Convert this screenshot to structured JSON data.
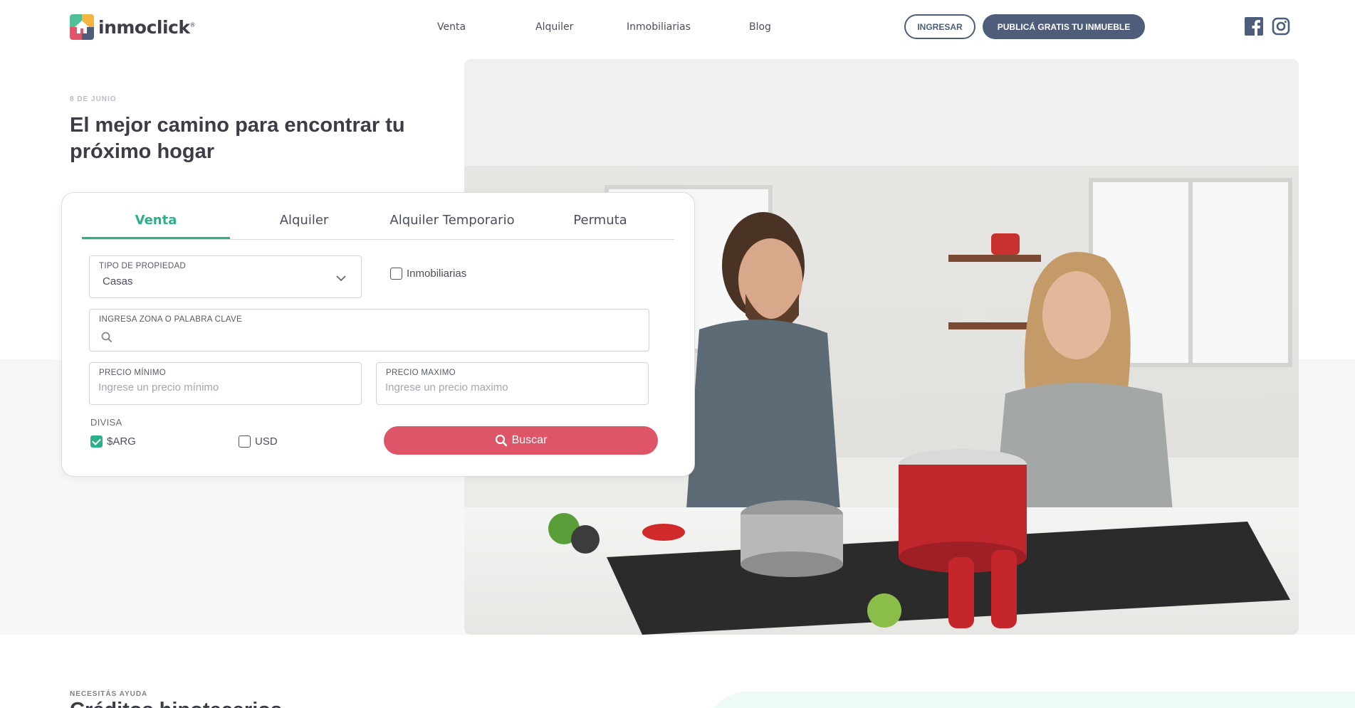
{
  "brand": {
    "name": "inmoclick",
    "trademark": "®"
  },
  "nav": {
    "items": [
      "Venta",
      "Alquiler",
      "Inmobiliarias",
      "Blog"
    ]
  },
  "header": {
    "login_label": "INGRESAR",
    "publish_label": "PUBLICÁ GRATIS TU INMUEBLE"
  },
  "social": {
    "facebook_icon": "facebook-icon",
    "instagram_icon": "instagram-icon"
  },
  "hero": {
    "date": "8 DE JUNIO",
    "title": "El mejor camino para encontrar tu próximo hogar"
  },
  "search": {
    "tabs": [
      "Venta",
      "Alquiler",
      "Alquiler Temporario",
      "Permuta"
    ],
    "active_tab": "Venta",
    "property_type": {
      "label": "TIPO DE PROPIEDAD",
      "value": "Casas"
    },
    "agencies_checkbox": {
      "label": "Inmobiliarias",
      "checked": false
    },
    "keyword": {
      "label": "INGRESA ZONA O PALABRA CLAVE",
      "value": "",
      "placeholder": ""
    },
    "min_price": {
      "label": "PRECIO MÍNIMO",
      "placeholder": "Ingrese un precio mínimo"
    },
    "max_price": {
      "label": "PRECIO MAXIMO",
      "placeholder": "Ingrese un precio maximo"
    },
    "currency": {
      "label": "DIVISA",
      "options": [
        {
          "label": "$ARG",
          "checked": true
        },
        {
          "label": "USD",
          "checked": false
        }
      ]
    },
    "submit_label": "Buscar"
  },
  "help_section": {
    "eyebrow": "NECESITÁS AYUDA",
    "title": "Créditos hipotecarios"
  },
  "colors": {
    "accent_green": "#2bb08a",
    "primary_navy": "#4d5d7a",
    "cta_red": "#df5568"
  }
}
